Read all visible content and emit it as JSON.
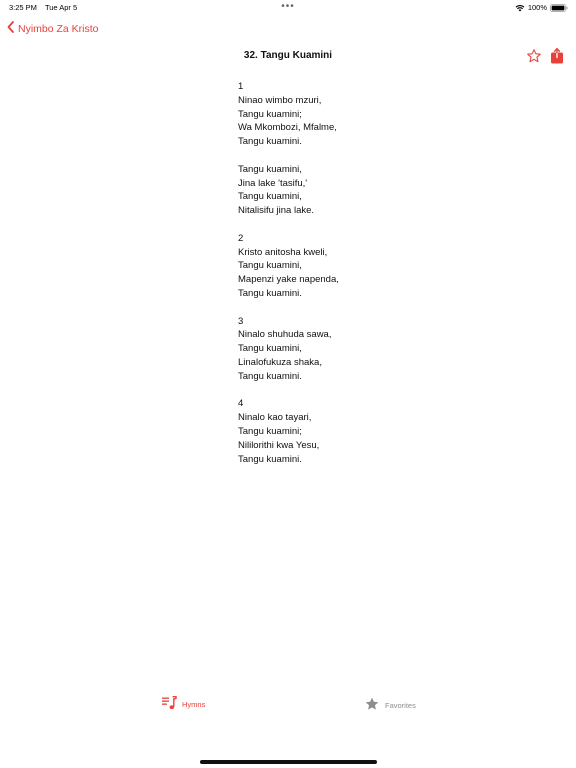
{
  "status_bar": {
    "time": "3:25 PM",
    "date": "Tue Apr 5",
    "center": "•••",
    "battery": "100%"
  },
  "nav": {
    "back_label": "Nyimbo Za Kristo",
    "title": "32. Tangu Kuamini"
  },
  "lyrics": {
    "stanzas": [
      [
        "1",
        "Ninao wimbo mzuri,",
        "Tangu kuamini;",
        "Wa Mkombozi, Mfalme,",
        "Tangu kuamini."
      ],
      [
        "Tangu kuamini,",
        "Jina lake 'tasifu,'",
        "Tangu kuamini,",
        "Nitalisifu jina lake."
      ],
      [
        "2",
        "Kristo anitosha kweli,",
        "Tangu kuamini,",
        "Mapenzi yake napenda,",
        "Tangu kuamini."
      ],
      [
        "3",
        "Ninalo shuhuda sawa,",
        "Tangu kuamini,",
        "Linalofukuza shaka,",
        "Tangu kuamini."
      ],
      [
        "4",
        "Ninalo kao tayari,",
        "Tangu kuamini;",
        "Nililorithi kwa Yesu,",
        "Tangu kuamini."
      ]
    ]
  },
  "tab_bar": {
    "hymns_label": "Hymns",
    "favorites_label": "Favorites"
  },
  "icons": {
    "back": "chevron-left-icon",
    "star": "star-outline-icon",
    "share": "share-icon",
    "hymns": "music-list-icon",
    "favorites": "star-filled-icon"
  },
  "colors": {
    "accent": "#e8413a",
    "inactive": "#8e8e8e"
  }
}
